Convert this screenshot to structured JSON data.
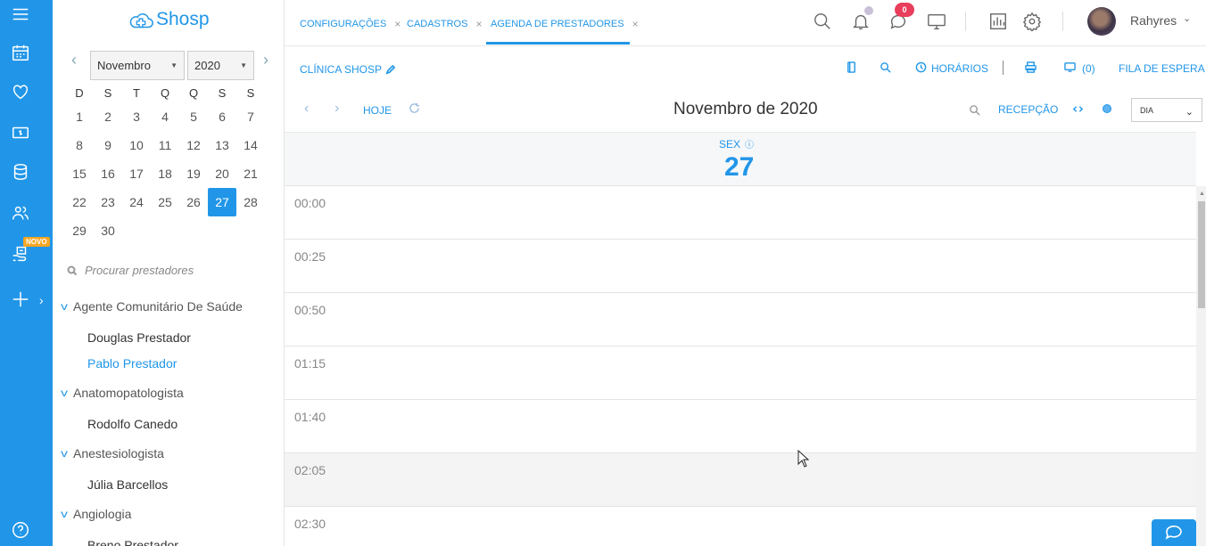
{
  "brand": {
    "logo_text": "Shosp",
    "accent": "#2196e8",
    "rail_badge": "NOVO"
  },
  "calendar": {
    "month": "Novembro",
    "year": "2020",
    "weekdays": [
      "D",
      "S",
      "T",
      "Q",
      "Q",
      "S",
      "S"
    ],
    "weeks": [
      [
        "1",
        "2",
        "3",
        "4",
        "5",
        "6",
        "7"
      ],
      [
        "8",
        "9",
        "10",
        "11",
        "12",
        "13",
        "14"
      ],
      [
        "15",
        "16",
        "17",
        "18",
        "19",
        "20",
        "21"
      ],
      [
        "22",
        "23",
        "24",
        "25",
        "26",
        "27",
        "28"
      ],
      [
        "29",
        "30",
        "",
        "",
        "",
        "",
        ""
      ]
    ],
    "selected_day": "27"
  },
  "providers": {
    "search_placeholder": "Procurar prestadores",
    "groups": [
      {
        "name": "Agente Comunitário De Saúde",
        "items": [
          "Douglas Prestador",
          "Pablo Prestador"
        ]
      },
      {
        "name": "Anatomopatologista",
        "items": [
          "Rodolfo Canedo"
        ]
      },
      {
        "name": "Anestesiologista",
        "items": [
          "Júlia Barcellos"
        ]
      },
      {
        "name": "Angiologia",
        "items": [
          "Breno Prestador"
        ]
      }
    ],
    "active_item": "Pablo Prestador"
  },
  "tabs": [
    {
      "label": "CONFIGURAÇÕES"
    },
    {
      "label": "CADASTROS"
    },
    {
      "label": "AGENDA DE PRESTADORES"
    }
  ],
  "header": {
    "messages_count": "0",
    "username": "Rahyres"
  },
  "toolbar": {
    "clinic": "CLÍNICA SHOSP",
    "horarios": "HORÁRIOS",
    "waiting_count": "(0)",
    "fila": "FILA DE ESPERA",
    "today": "HOJE",
    "month_title": "Novembro de 2020",
    "recepcao": "RECEPÇÃO",
    "view": "DIA"
  },
  "day": {
    "name": "SEX",
    "number": "27"
  },
  "slots": [
    {
      "time": "00:00",
      "past": false
    },
    {
      "time": "00:25",
      "past": false
    },
    {
      "time": "00:50",
      "past": false
    },
    {
      "time": "01:15",
      "past": false
    },
    {
      "time": "01:40",
      "past": false
    },
    {
      "time": "02:05",
      "past": true
    },
    {
      "time": "02:30",
      "past": false
    }
  ]
}
